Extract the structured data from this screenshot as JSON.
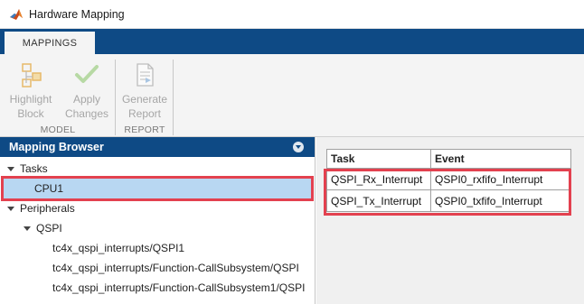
{
  "window": {
    "title": "Hardware Mapping"
  },
  "tabs": [
    {
      "label": "MAPPINGS"
    }
  ],
  "ribbon": {
    "groups": [
      {
        "label": "MODEL",
        "buttons": [
          {
            "label": "Highlight Block",
            "icon": "highlight-block-icon"
          },
          {
            "label": "Apply Changes",
            "icon": "checkmark-icon"
          }
        ]
      },
      {
        "label": "REPORT",
        "buttons": [
          {
            "label": "Generate Report",
            "icon": "report-icon"
          }
        ]
      }
    ]
  },
  "browser": {
    "header": "Mapping Browser",
    "tree": {
      "tasks_label": "Tasks",
      "task_items": [
        "CPU1"
      ],
      "peripherals_label": "Peripherals",
      "qspi_label": "QSPI",
      "qspi_items": [
        "tc4x_qspi_interrupts/QSPI1",
        "tc4x_qspi_interrupts/Function-CallSubsystem/QSPI",
        "tc4x_qspi_interrupts/Function-CallSubsystem1/QSPI"
      ]
    }
  },
  "table": {
    "columns": [
      "Task",
      "Event"
    ],
    "rows": [
      [
        "QSPI_Rx_Interrupt",
        "QSPI0_rxfifo_Interrupt"
      ],
      [
        "QSPI_Tx_Interrupt",
        "QSPI0_txfifo_Interrupt"
      ]
    ]
  },
  "colors": {
    "accent": "#0e4a85",
    "selection": "#b8d7f2",
    "highlight": "#e3414f"
  }
}
